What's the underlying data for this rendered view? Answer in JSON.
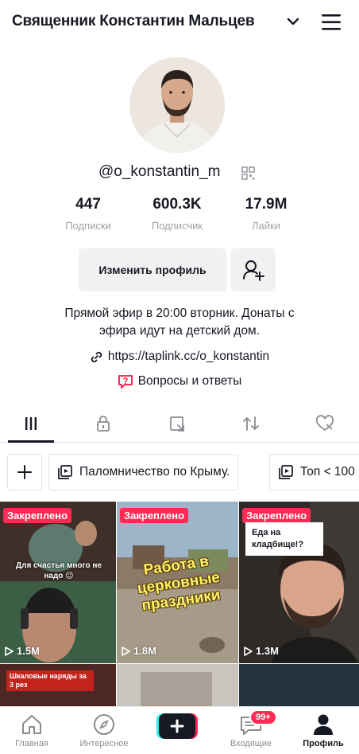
{
  "header": {
    "title": "Священник Константин Мальцев"
  },
  "profile": {
    "handle": "@o_konstantin_m",
    "stats": [
      {
        "value": "447",
        "label": "Подписки"
      },
      {
        "value": "600.3K",
        "label": "Подписчик"
      },
      {
        "value": "17.9M",
        "label": "Лайки"
      }
    ],
    "edit_label": "Изменить профиль",
    "bio_line1": "Прямой эфир в 20:00 вторник. Донаты с",
    "bio_line2": "эфира идут на детский дом.",
    "link": "https://taplink.cc/o_konstantin",
    "qa": "Вопросы и ответы"
  },
  "playlists": [
    {
      "label": "Паломничество по Крыму."
    },
    {
      "label": "Топ < 100"
    }
  ],
  "videos": [
    {
      "pinned": "Закреплено",
      "caption": "Для счастья много не надо 😉",
      "views": "1.5M"
    },
    {
      "pinned": "Закреплено",
      "caption": "Работа в церковные праздники",
      "views": "1.8M"
    },
    {
      "pinned": "Закреплено",
      "caption": "Еда на кладбище!?",
      "views": "1.3M"
    },
    {
      "caption": "Шкаловые наряды за 3 рез"
    }
  ],
  "nav": {
    "home": "Главная",
    "discover": "Интересное",
    "inbox": "Входящие",
    "inbox_badge": "99+",
    "profile": "Профиль"
  },
  "colors": {
    "accent": "#fe2c55",
    "cyan": "#25f4ee",
    "text": "#161823",
    "muted": "#a0a2a8"
  }
}
